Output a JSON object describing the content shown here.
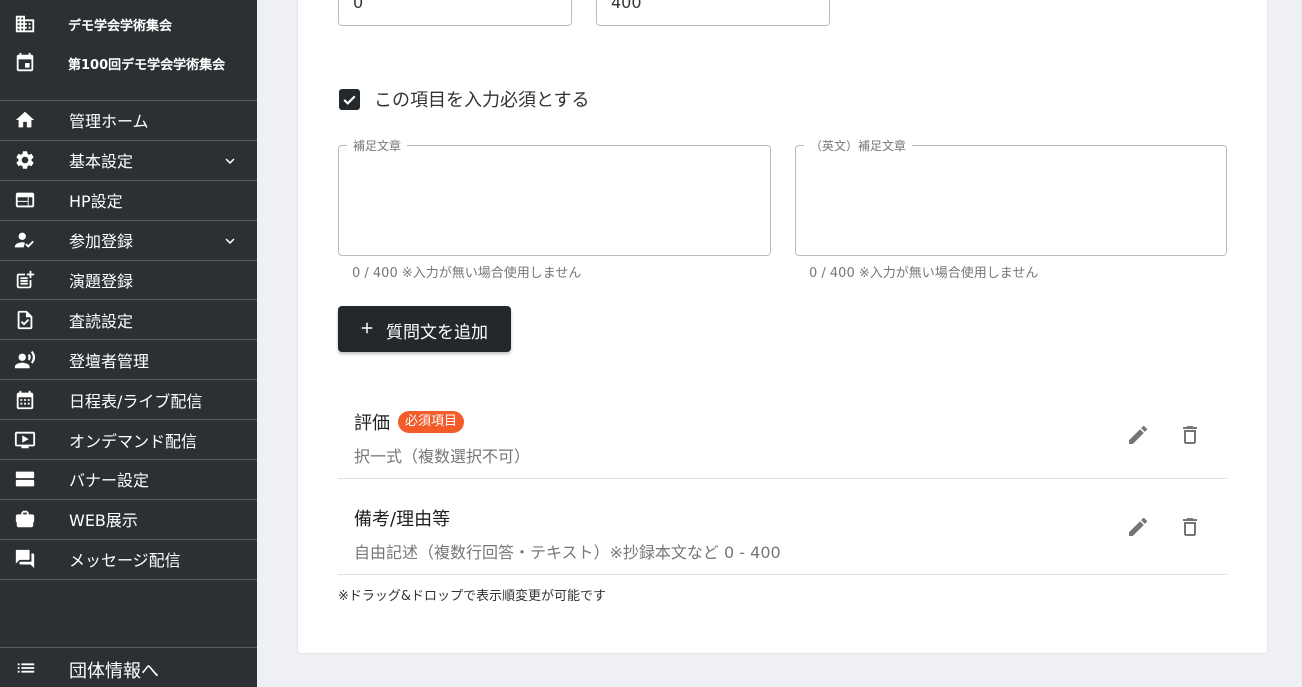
{
  "sidebar": {
    "org_name": "デモ学会学術集会",
    "event_name": "第100回デモ学会学術集会",
    "items": [
      {
        "label": "管理ホーム",
        "icon": "home-icon"
      },
      {
        "label": "基本設定",
        "icon": "gear-icon",
        "expandable": true
      },
      {
        "label": "HP設定",
        "icon": "web-icon"
      },
      {
        "label": "参加登録",
        "icon": "person-check-icon",
        "expandable": true
      },
      {
        "label": "演題登録",
        "icon": "post-add-icon"
      },
      {
        "label": "査読設定",
        "icon": "doc-check-icon"
      },
      {
        "label": "登壇者管理",
        "icon": "speaker-icon"
      },
      {
        "label": "日程表/ライブ配信",
        "icon": "calendar-icon"
      },
      {
        "label": "オンデマンド配信",
        "icon": "video-icon"
      },
      {
        "label": "バナー設定",
        "icon": "banner-icon"
      },
      {
        "label": "WEB展示",
        "icon": "briefcase-icon"
      },
      {
        "label": "メッセージ配信",
        "icon": "chat-icon"
      }
    ],
    "footer_label": "団体情報へ"
  },
  "form": {
    "min_value": "0",
    "max_value": "400",
    "required_label": "この項目を入力必須とする",
    "required_checked": true,
    "supplement": {
      "label": "補足文章",
      "value": "",
      "helper": "0 / 400 ※入力が無い場合使用しません"
    },
    "supplement_en": {
      "label": "（英文）補足文章",
      "value": "",
      "helper": "0 / 400 ※入力が無い場合使用しません"
    },
    "add_button_label": "質問文を追加"
  },
  "questions": [
    {
      "title": "評価",
      "badge": "必須項目",
      "subtitle": "択一式（複数選択不可）"
    },
    {
      "title": "備考/理由等",
      "badge": "",
      "subtitle": "自由記述（複数行回答・テキスト）※抄録本文など  0 - 400"
    }
  ],
  "note": "※ドラッグ&ドロップで表示順変更が可能です",
  "colors": {
    "sidebar_bg": "#2b3033",
    "accent_dark": "#23282c",
    "badge": "#f25c2b"
  }
}
